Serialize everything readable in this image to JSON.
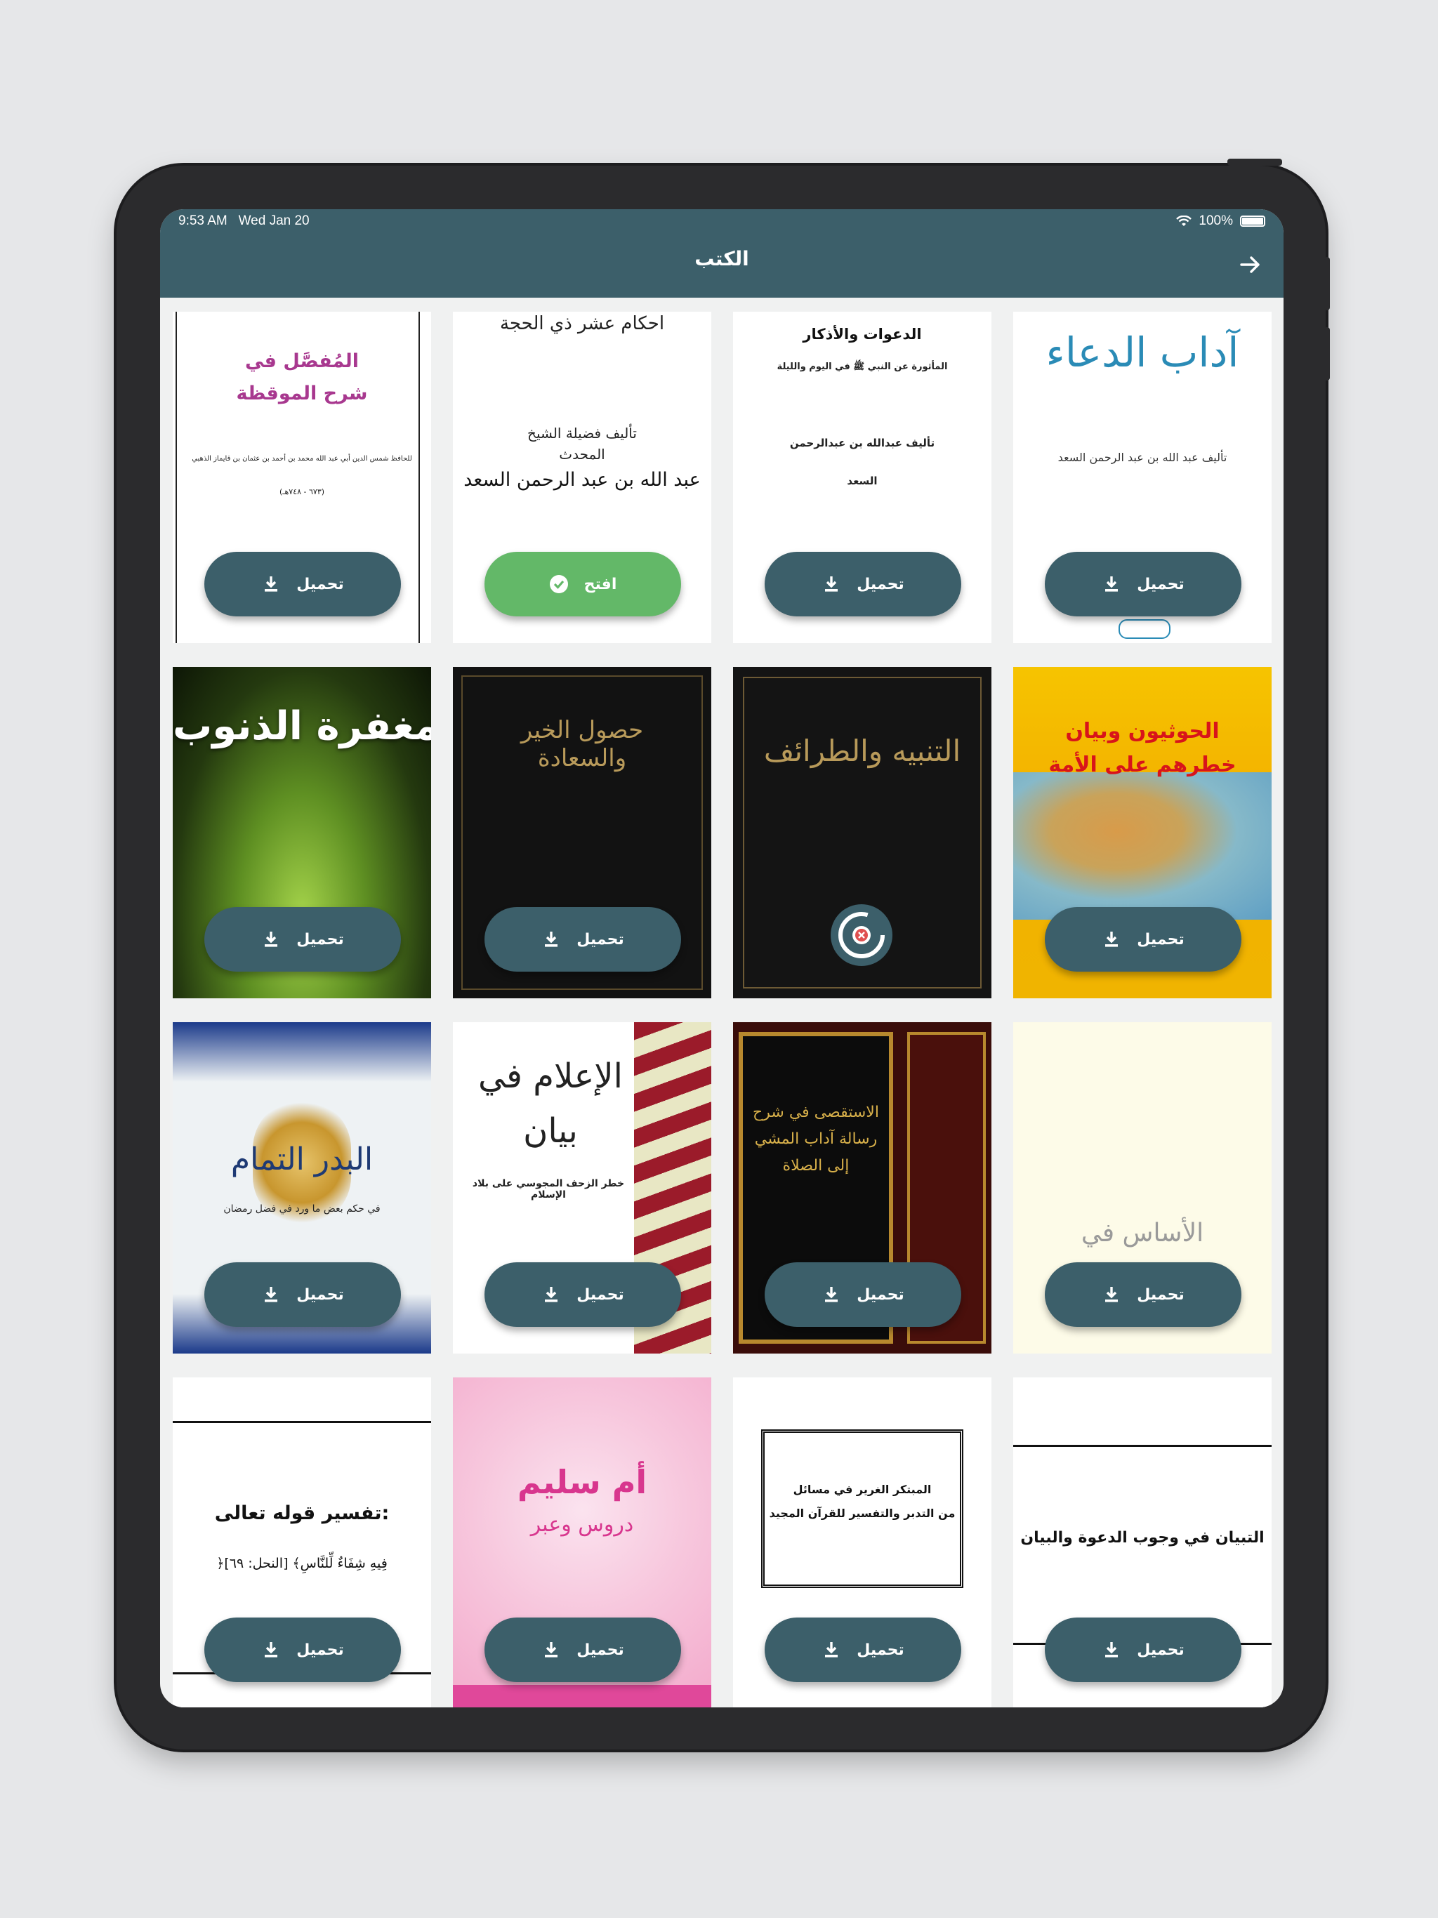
{
  "status_bar": {
    "time": "9:53 AM",
    "date": "Wed Jan 20",
    "battery": "100%"
  },
  "header": {
    "title": "الكتب",
    "back_icon": "arrow-right-icon"
  },
  "colors": {
    "bar": "#3c5f6a",
    "open": "#63b868"
  },
  "books": [
    {
      "cover_title": "آداب الدعاء",
      "cover_sub": "تأليف عبد الله بن عبد الرحمن السعد",
      "action": "تحميل",
      "state": "download"
    },
    {
      "cover_title": "الدعوات والأذكار",
      "cover_sub": "المأثورة عن النبي ﷺ في اليوم والليلة",
      "cover_author": "تأليف عبدالله بن عبدالرحمن السعد",
      "action": "تحميل",
      "state": "download"
    },
    {
      "cover_title": "احكام عشر ذي الحجة",
      "cover_sub": "تأليف فضيلة الشيخ المحدث",
      "cover_author": "عبد الله بن عبد الرحمن السعد",
      "action": "افتح",
      "state": "open"
    },
    {
      "cover_title": "المُفصَّل في شرح الموقظة",
      "cover_sub": "للحافظ شمس الدين أبي عبد الله محمد بن أحمد بن عثمان بن قايماز الذهبي",
      "cover_author": "(٦٧٣ - ٧٤٨هـ)",
      "action": "تحميل",
      "state": "download"
    },
    {
      "cover_title": "الحوثيون وبيان خطرهم على الأمة",
      "action": "تحميل",
      "state": "download"
    },
    {
      "cover_title": "التنبيه والطرائف",
      "action": "",
      "state": "loading"
    },
    {
      "cover_title": "حصول الخير والسعادة",
      "action": "تحميل",
      "state": "download"
    },
    {
      "cover_title": "مغفرة الذنوب",
      "action": "تحميل",
      "state": "download"
    },
    {
      "cover_title": "الأساس في",
      "action": "تحميل",
      "state": "download"
    },
    {
      "cover_title": "الاستقصى في شرح رسالة آداب المشي إلى الصلاة",
      "action": "تحميل",
      "state": "download"
    },
    {
      "cover_title": "الإعلام في بيان",
      "cover_sub": "خطر الزحف المجوسي على بلاد الإسلام",
      "action": "تحميل",
      "state": "download"
    },
    {
      "cover_title": "البدر التمام",
      "cover_sub": "في حكم بعض ما ورد في فضل رمضان",
      "action": "تحميل",
      "state": "download"
    },
    {
      "cover_title": "التبيان في وجوب الدعوة والبيان",
      "action": "تحميل",
      "state": "download"
    },
    {
      "cover_title": "المبتكر الغرير في مسائل",
      "cover_sub": "من التدبر والتفسير للقرآن المجيد",
      "action": "تحميل",
      "state": "download"
    },
    {
      "cover_title": "أم سليم",
      "cover_sub": "دروس وعبر",
      "action": "تحميل",
      "state": "download"
    },
    {
      "cover_title": "تفسير قوله تعالى:",
      "cover_sub": "﴿فِيهِ شِفَاءٌ لِّلنَّاسِ﴾ [النحل: ٦٩]",
      "action": "تحميل",
      "state": "download"
    }
  ]
}
